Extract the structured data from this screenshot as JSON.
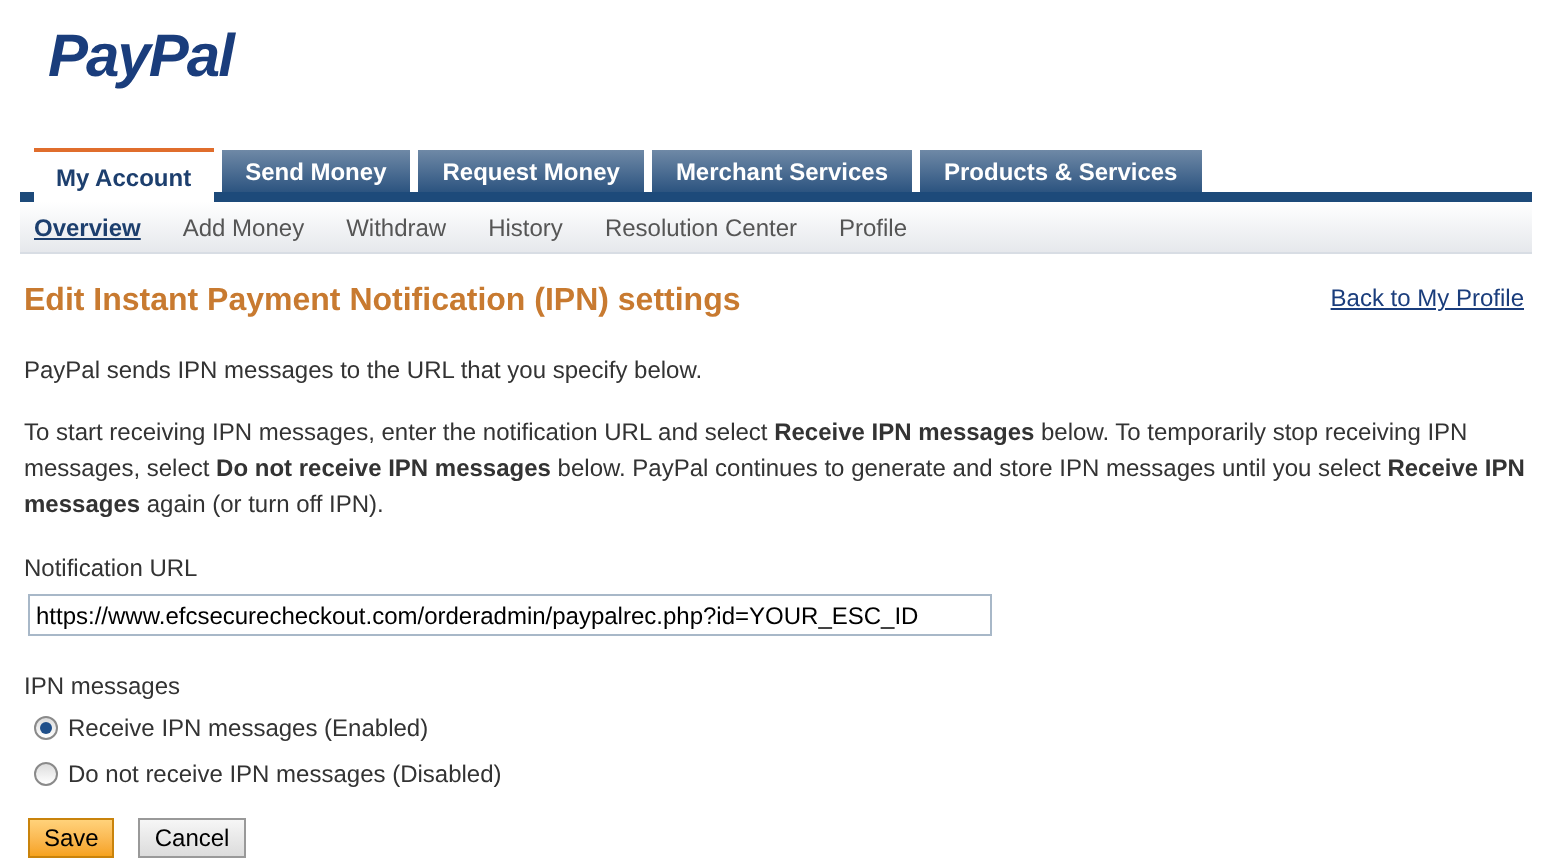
{
  "logo": "PayPal",
  "tabs": [
    {
      "label": "My Account",
      "selected": true
    },
    {
      "label": "Send Money",
      "selected": false
    },
    {
      "label": "Request Money",
      "selected": false
    },
    {
      "label": "Merchant Services",
      "selected": false
    },
    {
      "label": "Products & Services",
      "selected": false
    }
  ],
  "sub_nav": [
    {
      "label": "Overview",
      "selected": true
    },
    {
      "label": "Add Money",
      "selected": false
    },
    {
      "label": "Withdraw",
      "selected": false
    },
    {
      "label": "History",
      "selected": false
    },
    {
      "label": "Resolution Center",
      "selected": false
    },
    {
      "label": "Profile",
      "selected": false
    }
  ],
  "page_title": "Edit Instant Payment Notification (IPN) settings",
  "back_link": "Back to My Profile",
  "intro": "PayPal sends IPN messages to the URL that you specify below.",
  "instructions": "To start receiving IPN messages, enter the notification URL and select **Receive IPN messages** below. To temporarily stop receiving IPN messages, select **Do not receive IPN messages** below. PayPal continues to generate and store IPN messages until you select **Receive IPN messages** again (or turn off IPN).",
  "notification_url": {
    "label": "Notification URL",
    "value": "https://www.efcsecurecheckout.com/orderadmin/paypalrec.php?id=YOUR_ESC_ID"
  },
  "ipn_messages": {
    "label": "IPN messages",
    "options": [
      {
        "label": "Receive IPN messages (Enabled)",
        "selected": true
      },
      {
        "label": "Do not receive IPN messages (Disabled)",
        "selected": false
      }
    ]
  },
  "buttons": [
    {
      "label": "Save",
      "kind": "primary"
    },
    {
      "label": "Cancel",
      "kind": "secondary"
    }
  ]
}
